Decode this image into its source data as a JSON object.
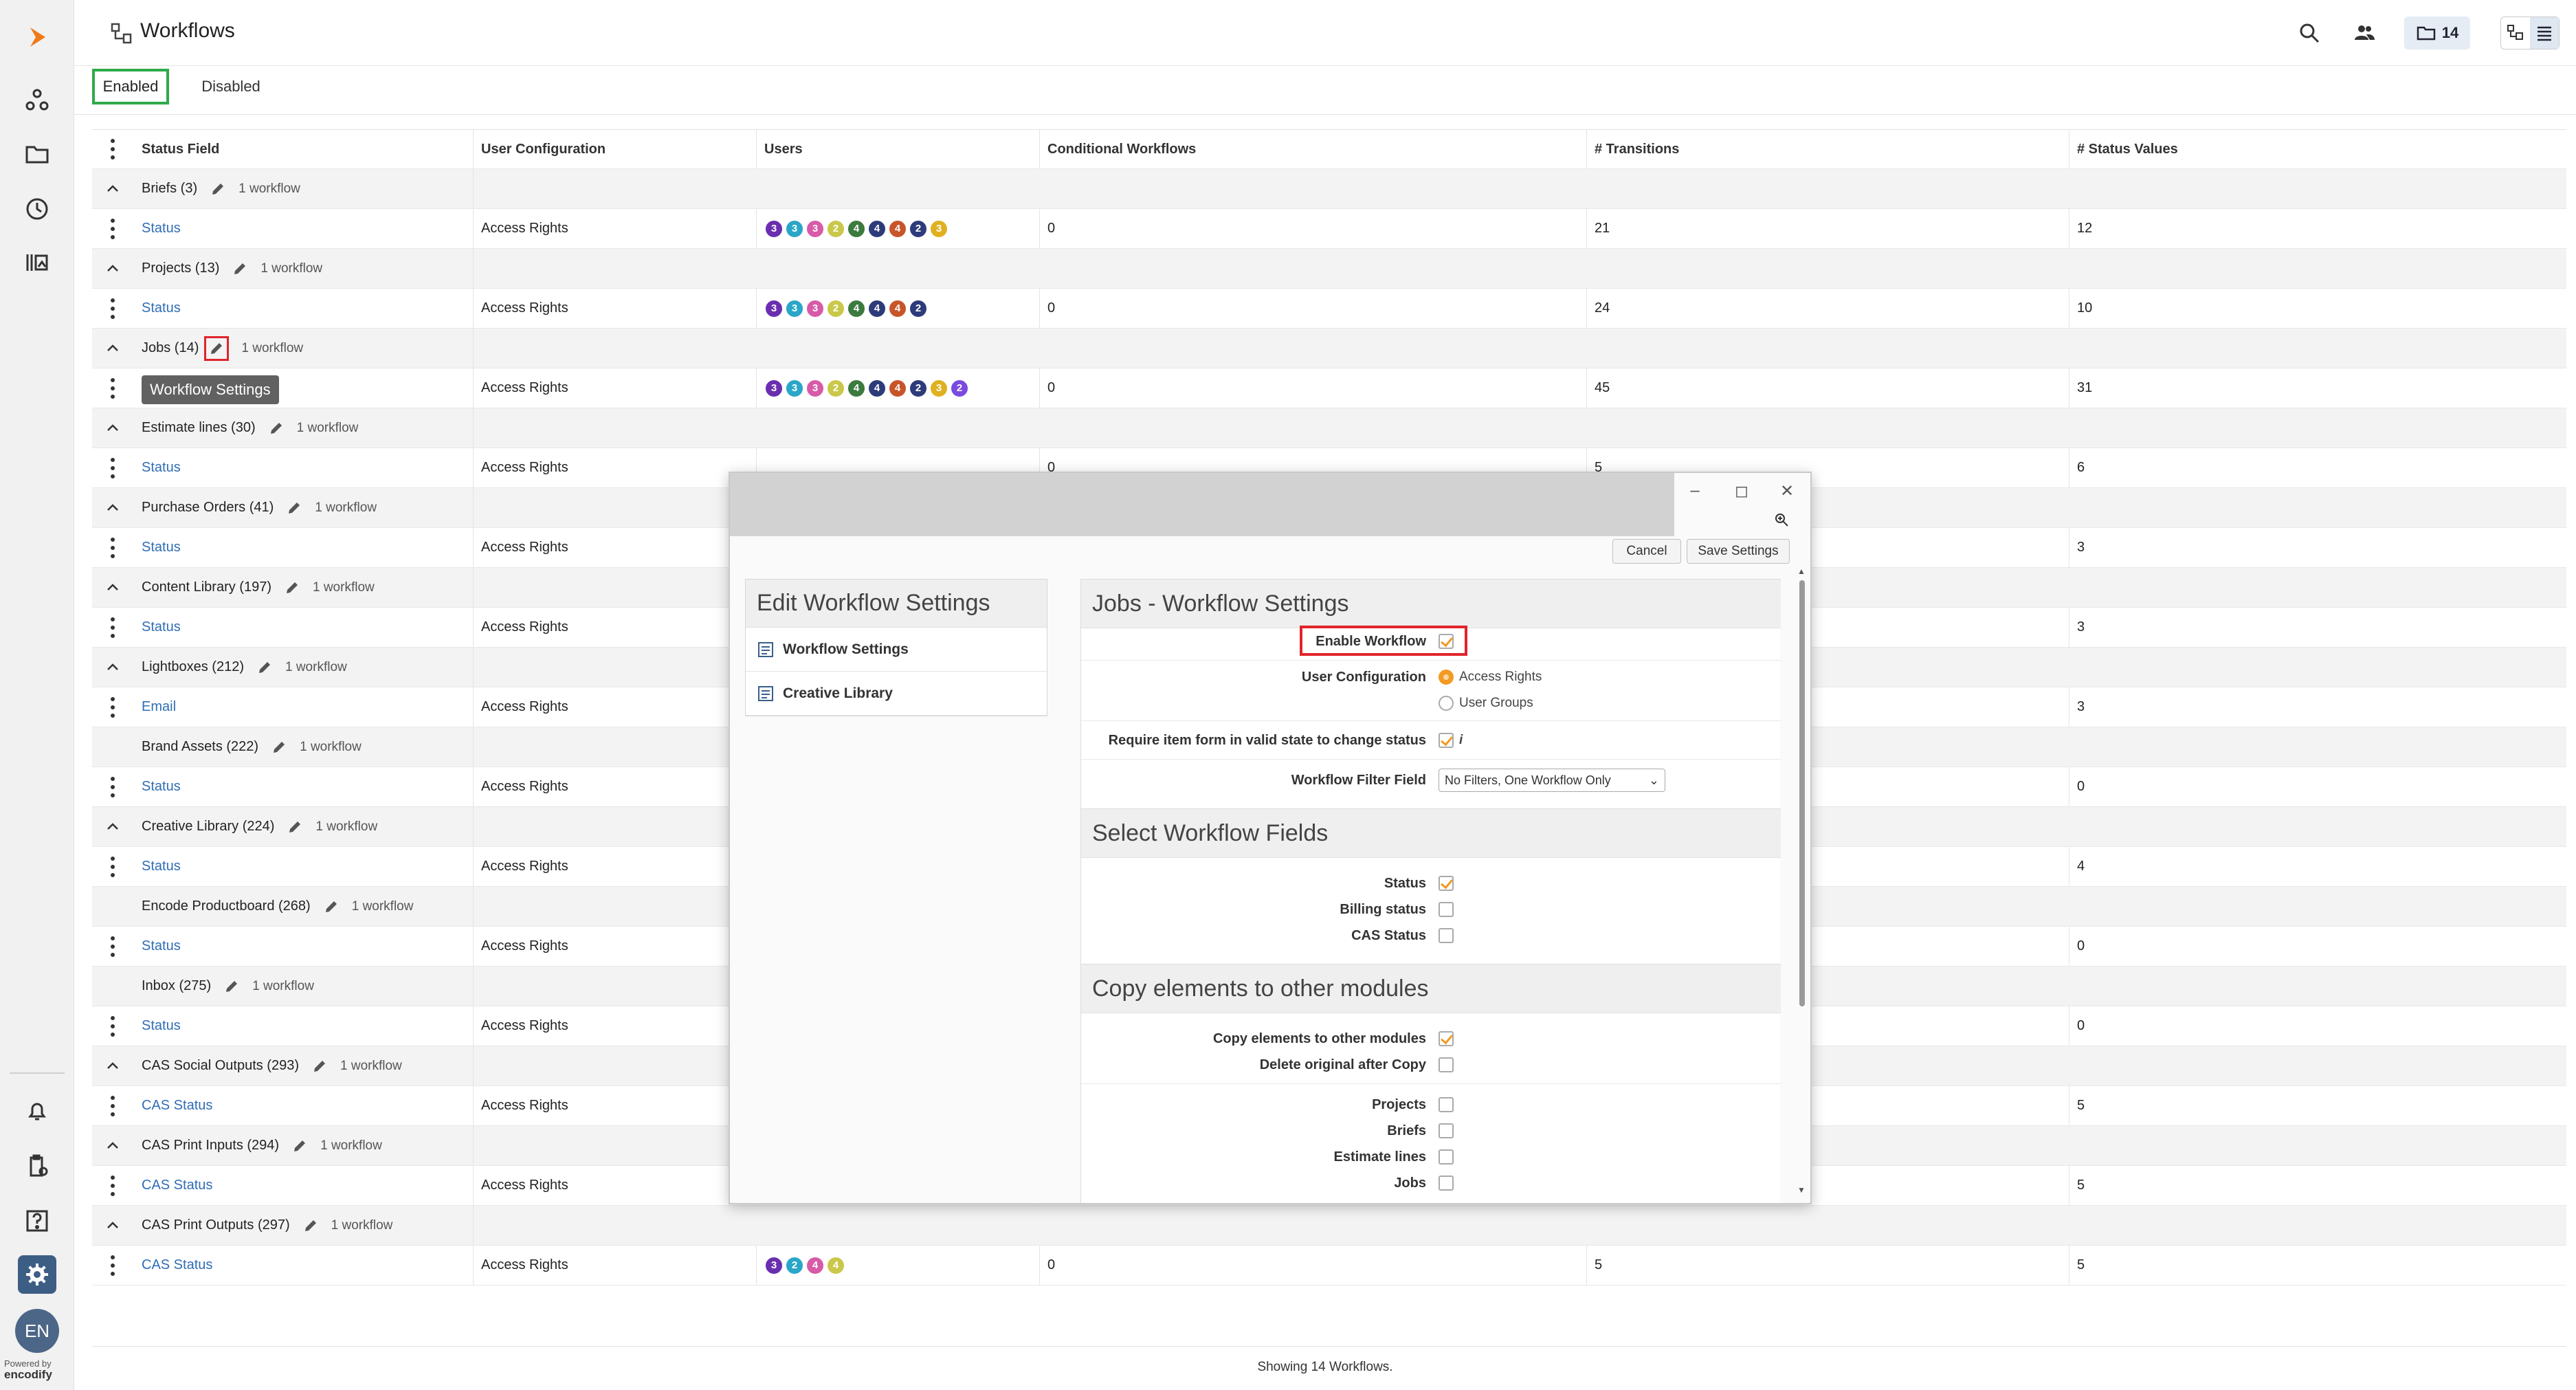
{
  "header": {
    "title": "Workflows",
    "folder_count": "14"
  },
  "tabs": [
    {
      "label": "Enabled"
    },
    {
      "label": "Disabled"
    }
  ],
  "table": {
    "columns": [
      "Status Field",
      "User Configuration",
      "Users",
      "Conditional Workflows",
      "# Transitions",
      "# Status Values"
    ],
    "groups": [
      {
        "name": "Briefs (3)",
        "count": "1 workflow",
        "expanded": true,
        "field": "Status",
        "config": "Access Rights",
        "users": [
          "3",
          "3",
          "3",
          "2",
          "4",
          "4",
          "4",
          "2",
          "3"
        ],
        "cond": "0",
        "trans": "21",
        "vals": "12"
      },
      {
        "name": "Projects (13)",
        "count": "1 workflow",
        "expanded": true,
        "field": "Status",
        "config": "Access Rights",
        "users": [
          "3",
          "3",
          "3",
          "2",
          "4",
          "4",
          "4",
          "2"
        ],
        "cond": "0",
        "trans": "24",
        "vals": "10"
      },
      {
        "name": "Jobs (14)",
        "count": "1 workflow",
        "expanded": true,
        "field": "",
        "config": "Access Rights",
        "users": [
          "3",
          "3",
          "3",
          "2",
          "4",
          "4",
          "4",
          "2",
          "3",
          "2"
        ],
        "cond": "0",
        "trans": "45",
        "vals": "31"
      },
      {
        "name": "Estimate lines (30)",
        "count": "1 workflow",
        "expanded": true,
        "field": "Status",
        "config": "Access Rights",
        "users": [],
        "cond": "0",
        "trans": "5",
        "vals": "6"
      },
      {
        "name": "Purchase Orders (41)",
        "count": "1 workflow",
        "expanded": true,
        "field": "Status",
        "config": "Access Rights",
        "users": [],
        "cond": "",
        "trans": "",
        "vals": "3"
      },
      {
        "name": "Content Library (197)",
        "count": "1 workflow",
        "expanded": true,
        "field": "Status",
        "config": "Access Rights",
        "users": [],
        "cond": "",
        "trans": "",
        "vals": "3"
      },
      {
        "name": "Lightboxes (212)",
        "count": "1 workflow",
        "expanded": true,
        "field": "Email",
        "config": "Access Rights",
        "users": [],
        "cond": "",
        "trans": "",
        "vals": "3"
      },
      {
        "name": "Brand Assets (222)",
        "count": "1 workflow",
        "expanded": false,
        "field": "Status",
        "config": "Access Rights",
        "users": [],
        "cond": "",
        "trans": "",
        "vals": "0"
      },
      {
        "name": "Creative Library (224)",
        "count": "1 workflow",
        "expanded": true,
        "field": "Status",
        "config": "Access Rights",
        "users": [],
        "cond": "",
        "trans": "",
        "vals": "4"
      },
      {
        "name": "Encode Productboard (268)",
        "count": "1 workflow",
        "expanded": false,
        "field": "Status",
        "config": "Access Rights",
        "users": [],
        "cond": "",
        "trans": "",
        "vals": "0"
      },
      {
        "name": "Inbox (275)",
        "count": "1 workflow",
        "expanded": false,
        "field": "Status",
        "config": "Access Rights",
        "users": [],
        "cond": "",
        "trans": "",
        "vals": "0"
      },
      {
        "name": "CAS Social Outputs (293)",
        "count": "1 workflow",
        "expanded": true,
        "field": "CAS Status",
        "config": "Access Rights",
        "users": [],
        "cond": "",
        "trans": "",
        "vals": "5"
      },
      {
        "name": "CAS Print Inputs (294)",
        "count": "1 workflow",
        "expanded": true,
        "field": "CAS Status",
        "config": "Access Rights",
        "users": [],
        "cond": "",
        "trans": "",
        "vals": "5"
      },
      {
        "name": "CAS Print Outputs (297)",
        "count": "1 workflow",
        "expanded": true,
        "field": "CAS Status",
        "config": "Access Rights",
        "users": [
          "3",
          "2",
          "4",
          "4"
        ],
        "cond": "0",
        "trans": "5",
        "vals": "5"
      }
    ]
  },
  "bubble_colors": [
    "#6a2fb0",
    "#2aa6c8",
    "#d85aa8",
    "#c9c84a",
    "#3c7a3e",
    "#2d3b7a",
    "#c8552a",
    "#2d3b7a",
    "#e0b020",
    "#7a4be0"
  ],
  "tooltip": "Workflow Settings",
  "footer": {
    "status": "Showing 14 Workflows."
  },
  "dialog": {
    "cancel": "Cancel",
    "save": "Save Settings",
    "left_title": "Edit Workflow Settings",
    "left_items": [
      "Workflow Settings",
      "Creative Library"
    ],
    "main_title": "Jobs - Workflow Settings",
    "enable_workflow": "Enable Workflow",
    "user_configuration": "User Configuration",
    "opt_access_rights": "Access Rights",
    "opt_user_groups": "User Groups",
    "require_valid": "Require item form in valid state to change status",
    "filter_field_label": "Workflow Filter Field",
    "filter_field_value": "No Filters, One Workflow Only",
    "select_fields_title": "Select Workflow Fields",
    "fields": [
      {
        "label": "Status",
        "checked": true
      },
      {
        "label": "Billing status",
        "checked": false
      },
      {
        "label": "CAS Status",
        "checked": false
      }
    ],
    "copy_title": "Copy elements to other modules",
    "copy_label": "Copy elements to other modules",
    "delete_label": "Delete original after Copy",
    "modules": [
      {
        "label": "Projects"
      },
      {
        "label": "Briefs"
      },
      {
        "label": "Estimate lines"
      },
      {
        "label": "Jobs"
      }
    ]
  },
  "rail": {
    "avatar": "EN",
    "powered_by": "Powered by",
    "brand": "encodify"
  }
}
